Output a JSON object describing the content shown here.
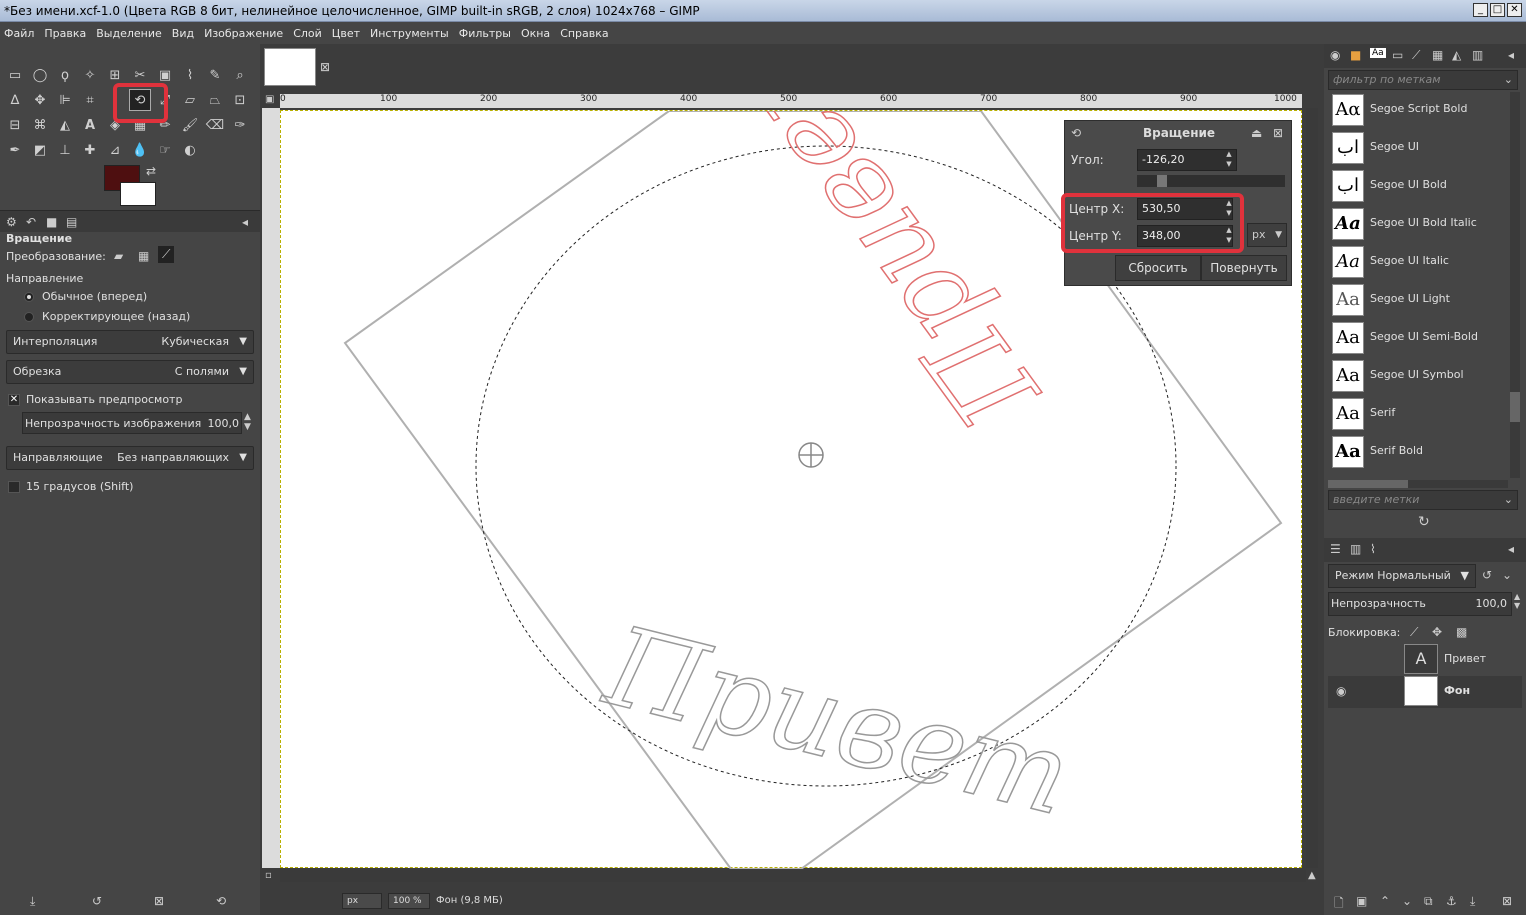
{
  "window": {
    "title": "*Без имени.xcf-1.0 (Цвета RGB 8 бит, нелинейное целочисленное, GIMP built-in sRGB, 2 слоя) 1024x768 – GIMP"
  },
  "menu": [
    "Файл",
    "Правка",
    "Выделение",
    "Вид",
    "Изображение",
    "Слой",
    "Цвет",
    "Инструменты",
    "Фильтры",
    "Окна",
    "Справка"
  ],
  "tool_options": {
    "title": "Вращение",
    "transform_label": "Преобразование:",
    "direction_label": "Направление",
    "direction_normal": "Обычное (вперед)",
    "direction_corrective": "Корректирующее (назад)",
    "interpolation_label": "Интерполяция",
    "interpolation_value": "Кубическая",
    "clipping_label": "Обрезка",
    "clipping_value": "С полями",
    "show_preview": "Показывать предпросмотр",
    "opacity_label": "Непрозрачность изображения",
    "opacity_value": "100,0",
    "guides_label": "Направляющие",
    "guides_value": "Без направляющих",
    "degrees15": "15 градусов (Shift)"
  },
  "ruler": [
    "0",
    "100",
    "200",
    "300",
    "400",
    "500",
    "600",
    "700",
    "800",
    "900",
    "1000"
  ],
  "rotate_dialog": {
    "title": "Вращение",
    "angle_label": "Угол:",
    "angle_value": "-126,20",
    "center_x_label": "Центр X:",
    "center_x_value": "530,50",
    "center_y_label": "Центр Y:",
    "center_y_value": "348,00",
    "unit": "px",
    "reset": "Сбросить",
    "rotate": "Повернуть"
  },
  "canvas_text": {
    "top": "Привет",
    "bottom": "Привет"
  },
  "statusbar": {
    "unit": "px",
    "zoom": "100 %",
    "info": "Фон (9,8 МБ)"
  },
  "fonts": {
    "filter_placeholder": "фильтр по меткам",
    "tags_placeholder": "введите метки",
    "items": [
      {
        "preview": "Aα",
        "name": "Segoe Script Bold"
      },
      {
        "preview": "اب",
        "name": "Segoe UI"
      },
      {
        "preview": "اب",
        "name": "Segoe UI Bold"
      },
      {
        "preview": "Aa",
        "name": "Segoe UI Bold Italic"
      },
      {
        "preview": "Aa",
        "name": "Segoe UI Italic"
      },
      {
        "preview": "Aa",
        "name": "Segoe UI Light"
      },
      {
        "preview": "Aa",
        "name": "Segoe UI Semi-Bold"
      },
      {
        "preview": "Aa",
        "name": "Segoe UI Symbol"
      },
      {
        "preview": "Aa",
        "name": "Serif"
      },
      {
        "preview": "Aa",
        "name": "Serif Bold"
      }
    ]
  },
  "layers": {
    "mode": "Режим Нормальный",
    "opacity_label": "Непрозрачность",
    "opacity_value": "100,0",
    "lock_label": "Блокировка:",
    "items": [
      {
        "name": "Привет"
      },
      {
        "name": "Фон"
      }
    ]
  }
}
